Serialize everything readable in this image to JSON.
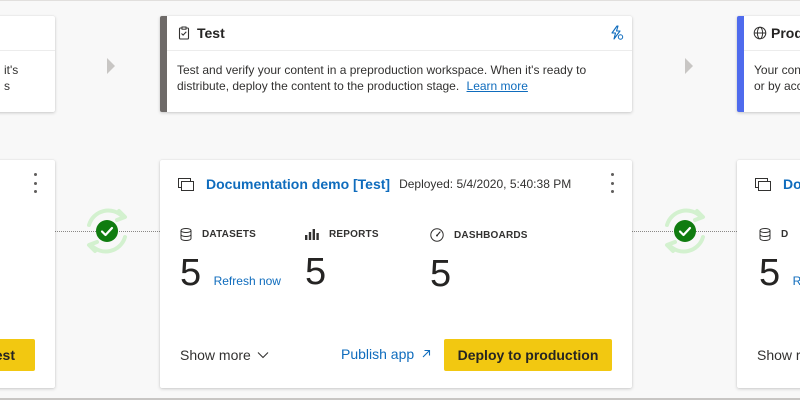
{
  "stages": {
    "left": {
      "desc_line1": "it's",
      "desc_line2": "s"
    },
    "test": {
      "title": "Test",
      "description": "Test and verify your content in a preproduction workspace. When it's ready to distribute, deploy the content to the production stage.",
      "learn_more": "Learn more",
      "accent_color": "#6e6a68"
    },
    "production": {
      "title": "Produ",
      "desc_line1": "Your con",
      "desc_line2": "or by acc",
      "accent_color": "#4f6bed"
    }
  },
  "workspaces": {
    "left": {
      "button_label": "est"
    },
    "test": {
      "name": "Documentation demo [Test]",
      "deployed": "Deployed: 5/4/2020, 5:40:38 PM",
      "metrics": {
        "datasets_label": "DATASETS",
        "datasets_value": "5",
        "refresh_label": "Refresh now",
        "reports_label": "REPORTS",
        "reports_value": "5",
        "dashboards_label": "DASHBOARDS",
        "dashboards_value": "5"
      },
      "show_more": "Show more",
      "publish_app": "Publish app",
      "deploy_button": "Deploy to production"
    },
    "production": {
      "name": "Do",
      "datasets_label": "D",
      "datasets_value": "5",
      "refresh_label": "Re",
      "show_more": "Show r"
    }
  },
  "colors": {
    "accent_yellow": "#f2c811",
    "link_blue": "#0f6cbd",
    "success_green": "#107c10"
  },
  "icons": [
    "clipboard-icon",
    "globe-icon",
    "pipeline-settings-icon",
    "workspace-icon",
    "database-icon",
    "bar-chart-icon",
    "gauge-icon",
    "sync-success-icon",
    "more-options-icon",
    "chevron-down-icon",
    "external-link-icon"
  ]
}
